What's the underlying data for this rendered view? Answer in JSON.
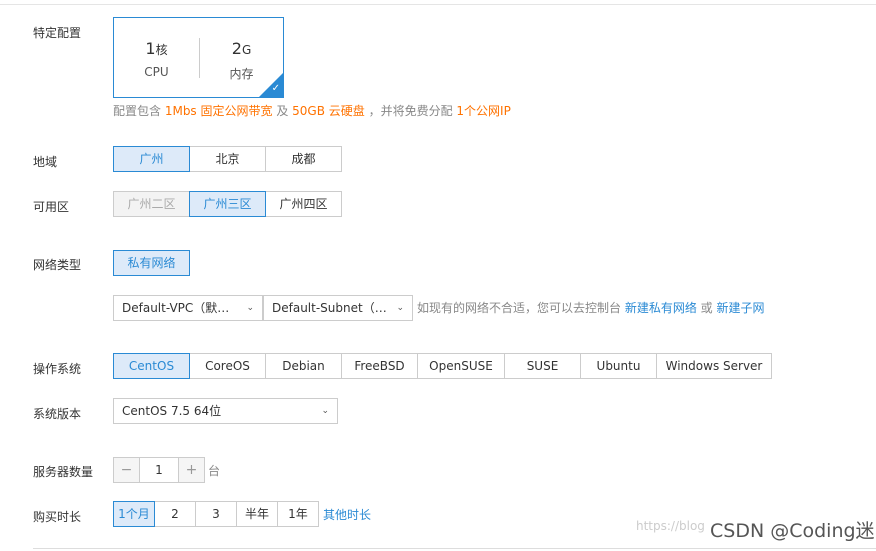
{
  "spec": {
    "label": "特定配置",
    "cpu_value": "1",
    "cpu_unit": "核",
    "cpu_name": "CPU",
    "mem_value": "2",
    "mem_unit": "G",
    "mem_name": "内存",
    "check_glyph": "✓"
  },
  "note": {
    "prefix": "配置包含 ",
    "bandwidth": "1Mbs 固定公网带宽",
    "and": " 及 ",
    "disk": "50GB 云硬盘",
    "mid": " ，并将免费分配 ",
    "ip": "1个公网IP"
  },
  "region": {
    "label": "地域",
    "options": [
      "广州",
      "北京",
      "成都"
    ],
    "selected": "广州"
  },
  "zone": {
    "label": "可用区",
    "options": [
      "广州二区",
      "广州三区",
      "广州四区"
    ],
    "selected": "广州三区",
    "disabled": "广州二区"
  },
  "network": {
    "label": "网络类型",
    "type_option": "私有网络",
    "vpc_value": "Default-VPC（默…",
    "subnet_value": "Default-Subnet（…",
    "hint_text": "如现有的网络不合适，您可以去控制台 ",
    "new_vpc_link": "新建私有网络",
    "or_text": " 或 ",
    "new_subnet_link": "新建子网"
  },
  "os": {
    "label": "操作系统",
    "options": [
      "CentOS",
      "CoreOS",
      "Debian",
      "FreeBSD",
      "OpenSUSE",
      "SUSE",
      "Ubuntu",
      "Windows Server"
    ],
    "selected": "CentOS"
  },
  "os_version": {
    "label": "系统版本",
    "value": "CentOS 7.5 64位"
  },
  "server_count": {
    "label": "服务器数量",
    "minus": "−",
    "value": "1",
    "plus": "+",
    "unit": "台"
  },
  "duration": {
    "label": "购买时长",
    "options": [
      "1个月",
      "2",
      "3",
      "半年",
      "1年"
    ],
    "selected": "1个月",
    "other_link": "其他时长"
  },
  "footer": {
    "watermark": "https://blog",
    "brand": "CSDN @Coding迷"
  },
  "colors": {
    "accent": "#2a8ad4",
    "highlight": "#ff7200",
    "selected_bg": "#ddeaf9"
  }
}
